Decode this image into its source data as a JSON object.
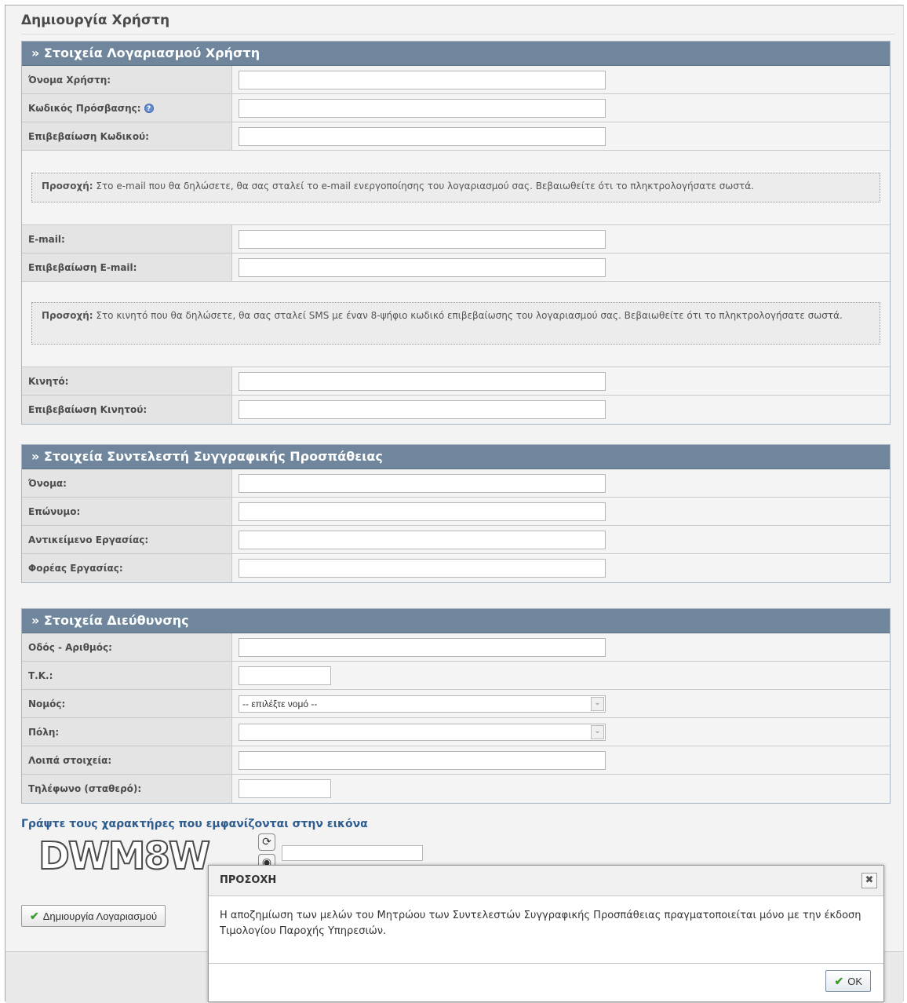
{
  "page_title": "Δημιουργία Χρήστη",
  "account_section": {
    "title": "» Στοιχεία Λογαριασμού Χρήστη",
    "username_label": "Όνομα Χρήστη:",
    "password_label": "Κωδικός Πρόσβασης:",
    "password_confirm_label": "Επιβεβαίωση Κωδικού:",
    "email_notice_strong": "Προσοχή:",
    "email_notice_text": " Στο e-mail που θα δηλώσετε, θα σας σταλεί το e-mail ενεργοποίησης του λογαριασμού σας. Βεβαιωθείτε ότι το πληκτρολογήσατε σωστά.",
    "email_label": "E-mail:",
    "email_confirm_label": "Επιβεβαίωση E-mail:",
    "mobile_notice_strong": "Προσοχή:",
    "mobile_notice_text": " Στο κινητό που θα δηλώσετε, θα σας σταλεί SMS με έναν 8-ψήφιο κωδικό επιβεβαίωσης του λογαριασμού σας. Βεβαιωθείτε ότι το πληκτρολογήσατε σωστά.",
    "mobile_label": "Κινητό:",
    "mobile_confirm_label": "Επιβεβαίωση Κινητού:"
  },
  "contributor_section": {
    "title": "» Στοιχεία Συντελεστή Συγγραφικής Προσπάθειας",
    "first_name_label": "Όνομα:",
    "last_name_label": "Επώνυμο:",
    "work_subject_label": "Αντικείμενο Εργασίας:",
    "employer_label": "Φορέας Εργασίας:"
  },
  "address_section": {
    "title": "» Στοιχεία Διεύθυνσης",
    "street_label": "Οδός - Αριθμός:",
    "postal_code_label": "Τ.Κ.:",
    "prefecture_label": "Νομός:",
    "prefecture_selected": "-- επιλέξτε νομό --",
    "city_label": "Πόλη:",
    "city_selected": "",
    "other_label": "Λοιπά στοιχεία:",
    "phone_label": "Τηλέφωνο (σταθερό):"
  },
  "captcha": {
    "title": "Γράψτε τους χαρακτήρες που εμφανίζονται στην εικόνα",
    "image_text": "DWM8W"
  },
  "create_button_label": "Δημιουργία Λογαριασμού",
  "dialog": {
    "title": "ΠΡΟΣΟΧΗ",
    "message": "Η αποζημίωση των μελών του Μητρώου των Συντελεστών Συγγραφικής Προσπάθειας πραγματοποιείται μόνο με την έκδοση Τιμολογίου Παροχής Υπηρεσιών.",
    "ok_label": "OK"
  },
  "icons": {
    "help": "help-icon",
    "refresh": "refresh-icon",
    "audio": "audio-icon",
    "check": "checkmark-icon",
    "close": "close-icon",
    "dropdown": "chevron-down-icon"
  }
}
